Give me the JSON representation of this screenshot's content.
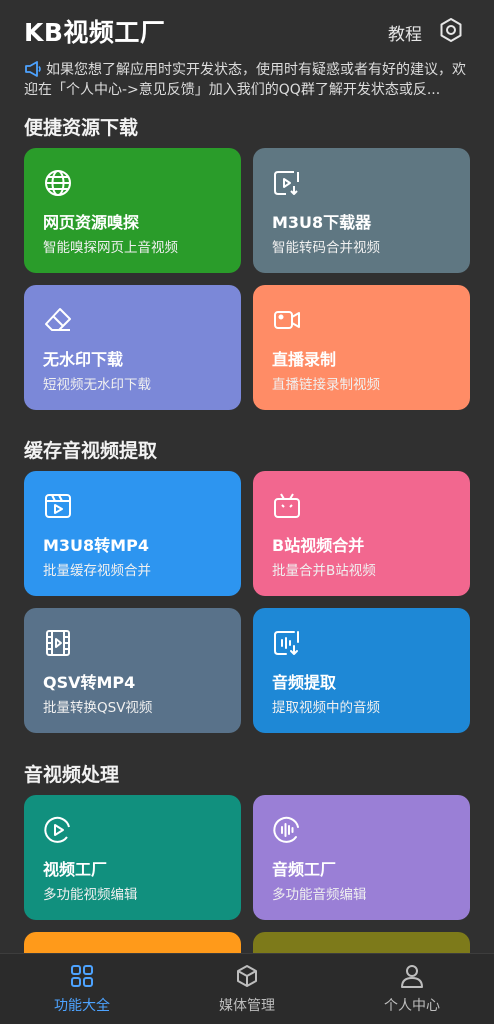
{
  "colors": {
    "background": "#303030",
    "accent": "#4da3ff",
    "web_sniff": "#2a9c2a",
    "m3u8_dl": "#5f7782",
    "no_watermark": "#7b88d8",
    "live_rec": "#ff8c66",
    "m3u8_mp4": "#2d95f0",
    "bili_merge": "#f2678f",
    "qsv_mp4": "#59728a",
    "audio_extract": "#1e88d6",
    "video_factory": "#11907e",
    "audio_factory": "#9a7fd6",
    "partial_left": "#ff9a1a",
    "partial_right": "#7d7a1a"
  },
  "header": {
    "title": "KB视频工厂",
    "tutorial": "教程",
    "settings_icon": "settings-icon"
  },
  "notice": {
    "icon": "megaphone-icon",
    "text": "如果您想了解应用时实开发状态，使用时有疑惑或者有好的建议，欢迎在「个人中心->意见反馈」加入我们的QQ群了解开发状态或反..."
  },
  "sections": {
    "quick_download": "便捷资源下载",
    "cache_extract": "缓存音视频提取",
    "av_processing": "音视频处理"
  },
  "cards": {
    "web_sniff": {
      "title": "网页资源嗅探",
      "subtitle": "智能嗅探网页上音视频",
      "icon": "globe-icon"
    },
    "m3u8_dl": {
      "title": "M3U8下载器",
      "subtitle": "智能转码合并视频",
      "icon": "video-download-icon"
    },
    "no_watermark": {
      "title": "无水印下载",
      "subtitle": "短视频无水印下载",
      "icon": "eraser-icon"
    },
    "live_rec": {
      "title": "直播录制",
      "subtitle": "直播链接录制视频",
      "icon": "video-camera-icon"
    },
    "m3u8_mp4": {
      "title": "M3U8转MP4",
      "subtitle": "批量缓存视频合并",
      "icon": "clapperboard-icon"
    },
    "bili_merge": {
      "title": "B站视频合并",
      "subtitle": "批量合并B站视频",
      "icon": "bilibili-tv-icon"
    },
    "qsv_mp4": {
      "title": "QSV转MP4",
      "subtitle": "批量转换QSV视频",
      "icon": "film-strip-icon"
    },
    "audio_extract": {
      "title": "音频提取",
      "subtitle": "提取视频中的音频",
      "icon": "audio-extract-icon"
    },
    "video_factory": {
      "title": "视频工厂",
      "subtitle": "多功能视频编辑",
      "icon": "play-circle-icon"
    },
    "audio_factory": {
      "title": "音频工厂",
      "subtitle": "多功能音频编辑",
      "icon": "audio-wave-icon"
    }
  },
  "bottom_nav": {
    "features": {
      "label": "功能大全",
      "icon": "grid-icon",
      "active": true
    },
    "media": {
      "label": "媒体管理",
      "icon": "cube-icon",
      "active": false
    },
    "profile": {
      "label": "个人中心",
      "icon": "user-icon",
      "active": false
    }
  }
}
